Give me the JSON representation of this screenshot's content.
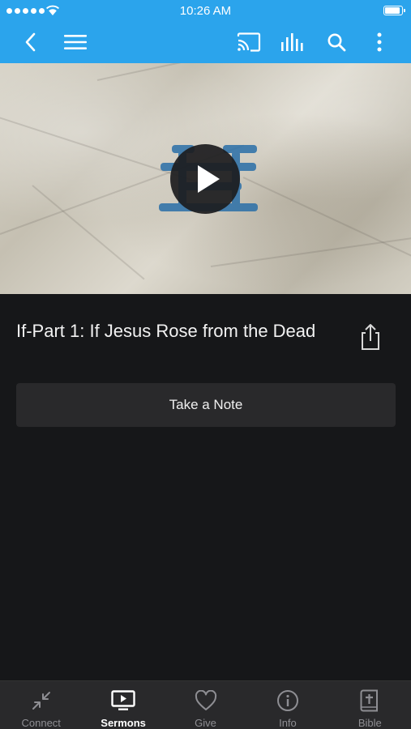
{
  "status_bar": {
    "time": "10:26 AM"
  },
  "nav": {
    "back_icon": "chevron-left-icon",
    "menu_icon": "hamburger-menu-icon",
    "cast_icon": "cast-icon",
    "audio_icon": "audio-levels-icon",
    "search_icon": "search-icon",
    "more_icon": "more-vertical-icon"
  },
  "sermon": {
    "title": "If-Part 1: If Jesus Rose from the Dead",
    "note_button": "Take a Note"
  },
  "tabs": [
    {
      "label": "Connect",
      "icon": "arrows-compress-icon",
      "active": false
    },
    {
      "label": "Sermons",
      "icon": "tv-play-icon",
      "active": true
    },
    {
      "label": "Give",
      "icon": "heart-icon",
      "active": false
    },
    {
      "label": "Info",
      "icon": "info-circle-icon",
      "active": false
    },
    {
      "label": "Bible",
      "icon": "bible-icon",
      "active": false
    }
  ],
  "colors": {
    "accent": "#2ba4ec",
    "background": "#161719",
    "tabbar": "#29292b"
  }
}
